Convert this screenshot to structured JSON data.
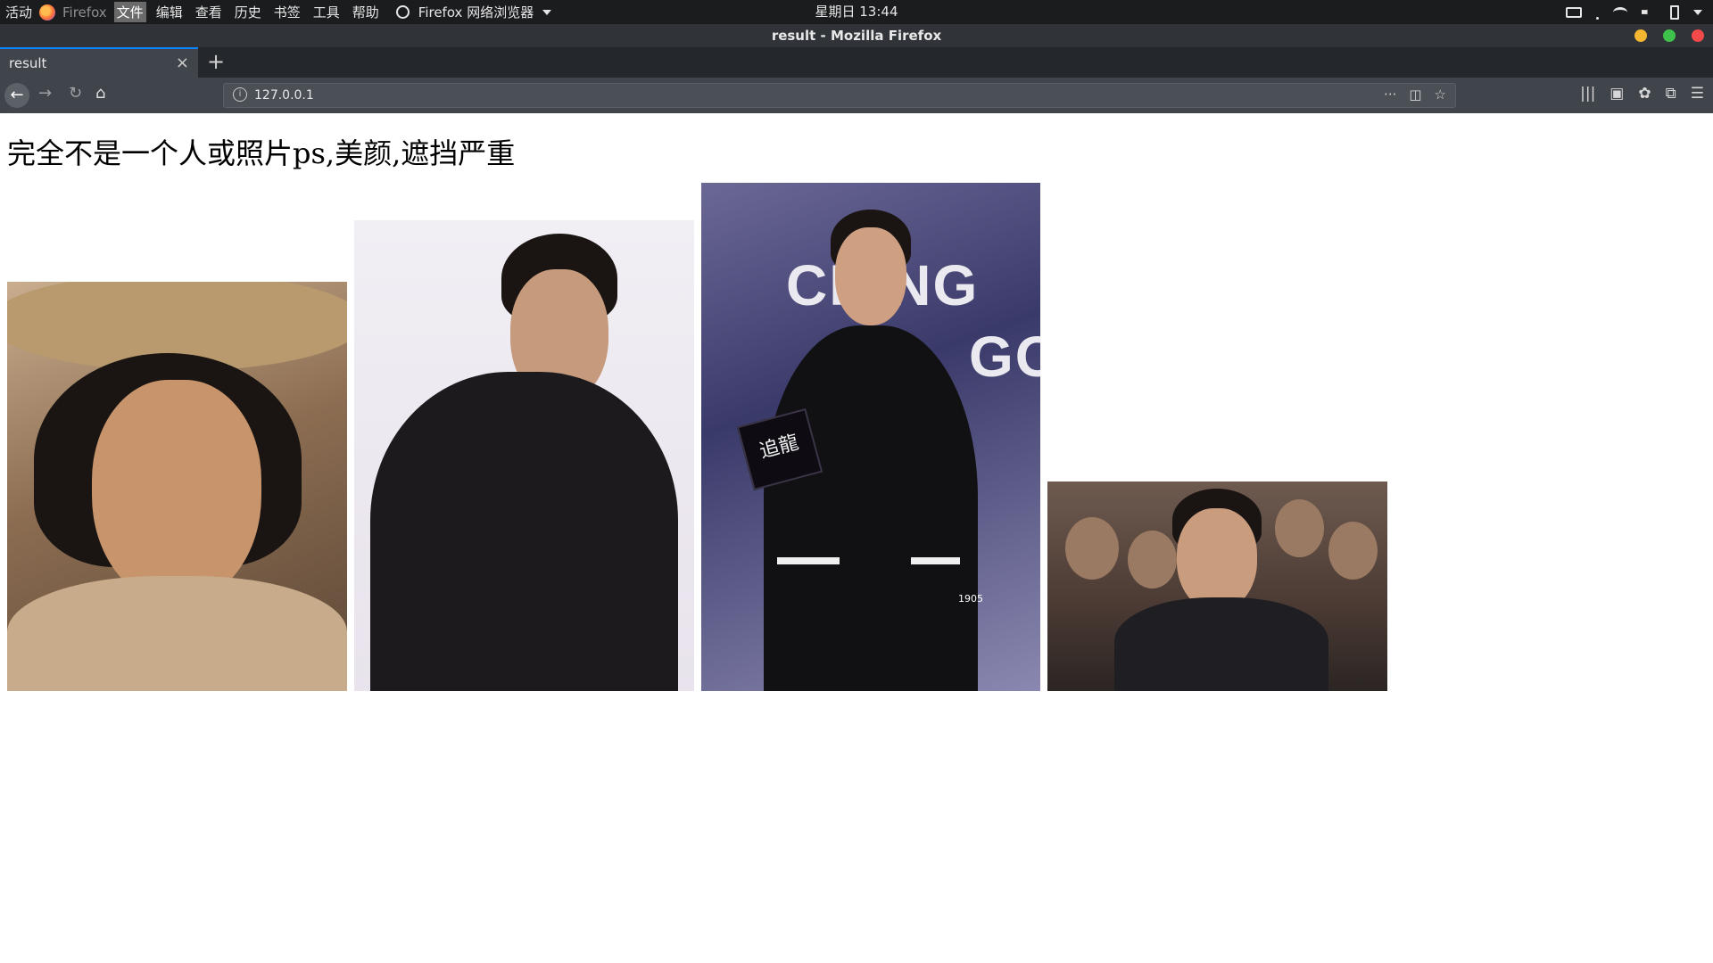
{
  "topbar": {
    "activities": "活动",
    "app_name": "Firefox",
    "menus": [
      "文件",
      "编辑",
      "查看",
      "历史",
      "书签",
      "工具",
      "帮助"
    ],
    "browser_menu": "Firefox 网络浏览器",
    "clock": "星期日 13:44"
  },
  "window": {
    "title": "result - Mozilla Firefox"
  },
  "tabs": [
    {
      "label": "result",
      "close": "×"
    }
  ],
  "newtab": "+",
  "navbar": {
    "url": "127.0.0.1",
    "info": "i",
    "page_actions": "···"
  },
  "page": {
    "heading": "完全不是一个人或照片ps,美颜,遮挡严重",
    "images": [
      {
        "desc": "portrait-straw-hat"
      },
      {
        "desc": "portrait-black-suit"
      },
      {
        "desc": "portrait-poster-microphone"
      },
      {
        "desc": "portrait-seated-crowd"
      }
    ]
  },
  "poster": {
    "line1": "CR   NG",
    "line2": "GON",
    "mic_text": "追龍",
    "watermark": "1905"
  }
}
